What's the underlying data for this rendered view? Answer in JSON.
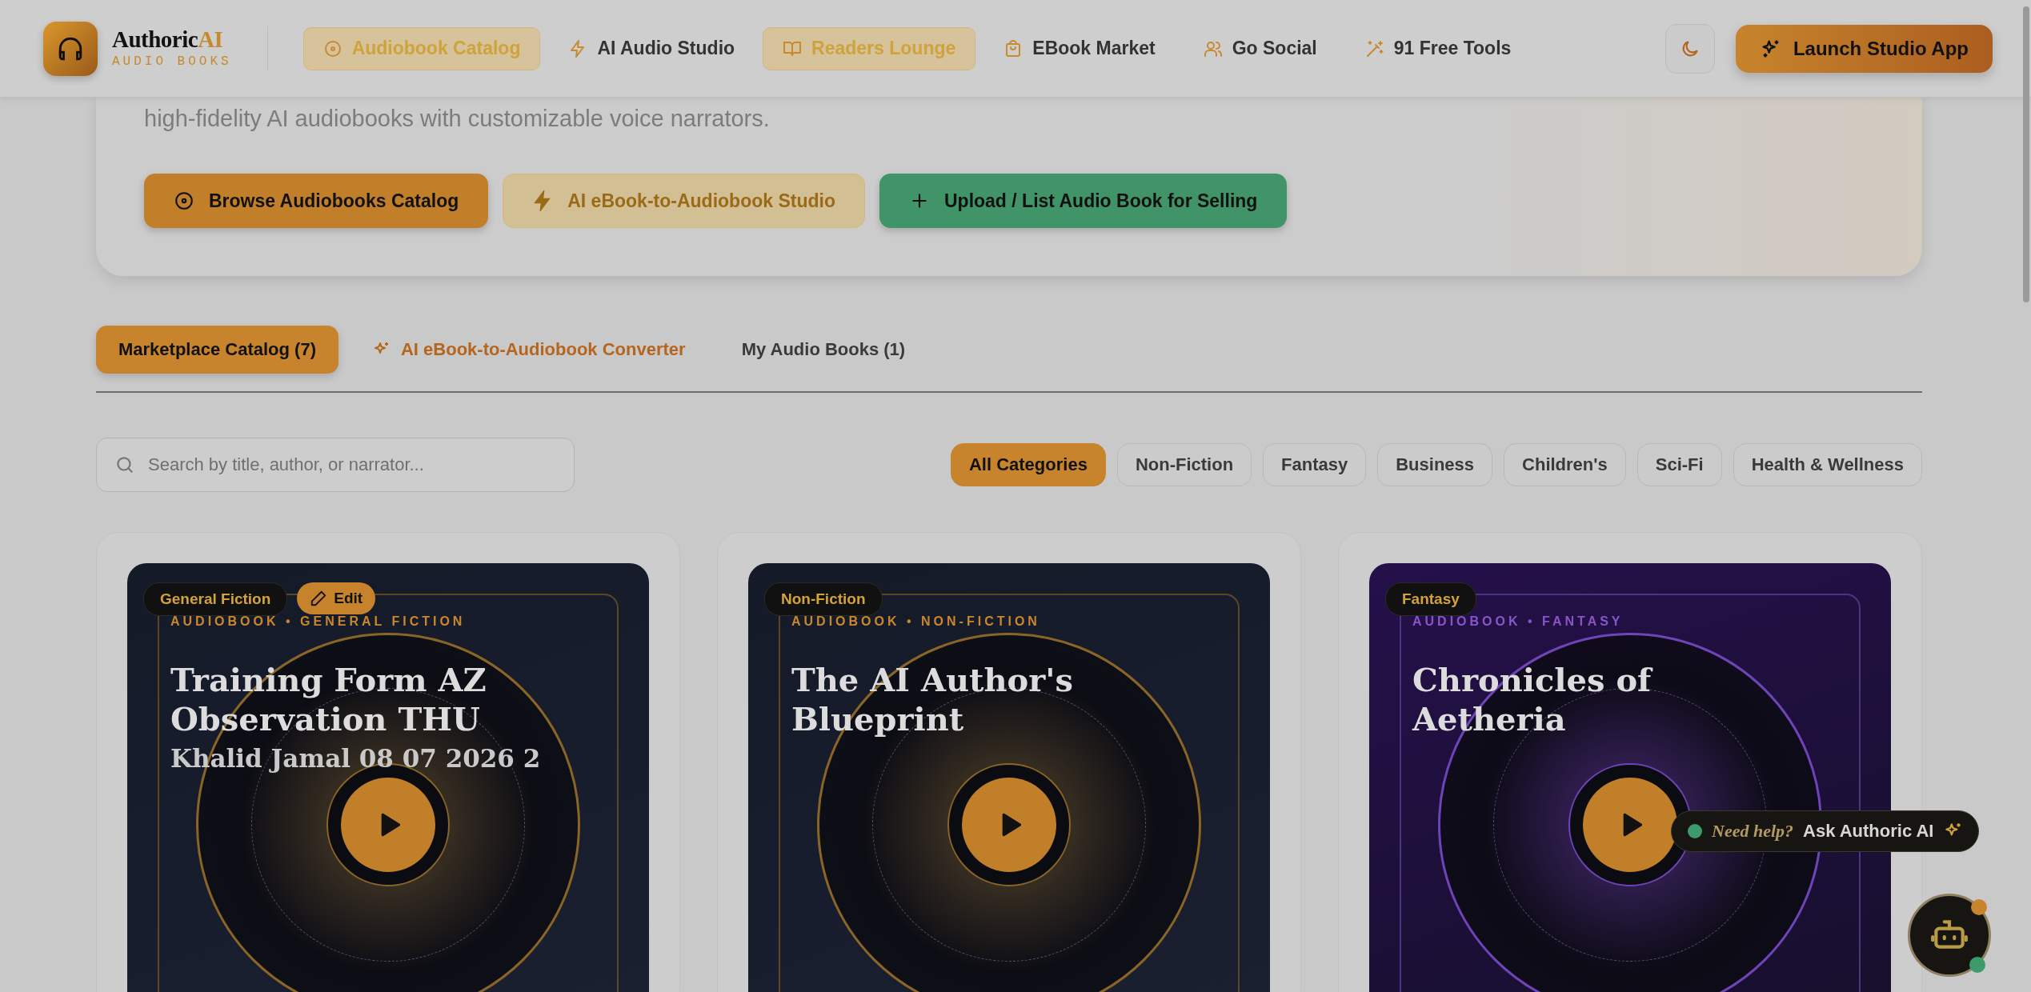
{
  "header": {
    "logo": {
      "name": "Authoric",
      "accent": "AI",
      "tagline": "AUDIO BOOKS"
    },
    "nav": [
      {
        "label": "Audiobook Catalog",
        "selected": true
      },
      {
        "label": "AI Audio Studio",
        "selected": false
      },
      {
        "label": "Readers Lounge",
        "selected": true
      },
      {
        "label": "EBook Market",
        "selected": false
      },
      {
        "label": "Go Social",
        "selected": false
      },
      {
        "label": "91 Free Tools",
        "selected": false
      }
    ],
    "launch_button": "Launch Studio App"
  },
  "hero": {
    "text": "high-fidelity AI audiobooks with customizable voice narrators.",
    "buttons": [
      {
        "label": "Browse Audiobooks Catalog",
        "kind": "primary"
      },
      {
        "label": "AI eBook-to-Audiobook Studio",
        "kind": "faded"
      },
      {
        "label": "Upload / List Audio Book for Selling",
        "kind": "success"
      }
    ]
  },
  "tabs": [
    {
      "label": "Marketplace Catalog (7)",
      "selected": true,
      "kind": "plain"
    },
    {
      "label": "AI eBook-to-Audiobook Converter",
      "selected": false,
      "kind": "accent"
    },
    {
      "label": "My Audio Books (1)",
      "selected": false,
      "kind": "plain"
    }
  ],
  "search": {
    "placeholder": "Search by title, author, or narrator..."
  },
  "categories": [
    {
      "label": "All Categories",
      "selected": true
    },
    {
      "label": "Non-Fiction",
      "selected": false
    },
    {
      "label": "Fantasy",
      "selected": false
    },
    {
      "label": "Business",
      "selected": false
    },
    {
      "label": "Children's",
      "selected": false
    },
    {
      "label": "Sci-Fi",
      "selected": false
    },
    {
      "label": "Health & Wellness",
      "selected": false
    }
  ],
  "books": [
    {
      "genre": "General Fiction",
      "edit": "Edit",
      "overline": "AUDIOBOOK • GENERAL FICTION",
      "title": "Training Form AZ Observation THU",
      "subtitle": "Khalid Jamal 08 07 2026 2",
      "kind": "navy"
    },
    {
      "genre": "Non-Fiction",
      "overline": "AUDIOBOOK • NON-FICTION",
      "title": "The AI Author's Blueprint",
      "kind": "navy"
    },
    {
      "genre": "Fantasy",
      "overline": "AUDIOBOOK • FANTASY",
      "title": "Chronicles of Aetheria",
      "kind": "purple"
    }
  ],
  "chat": {
    "prompt": "Need help?",
    "label": "Ask Authoric AI"
  }
}
